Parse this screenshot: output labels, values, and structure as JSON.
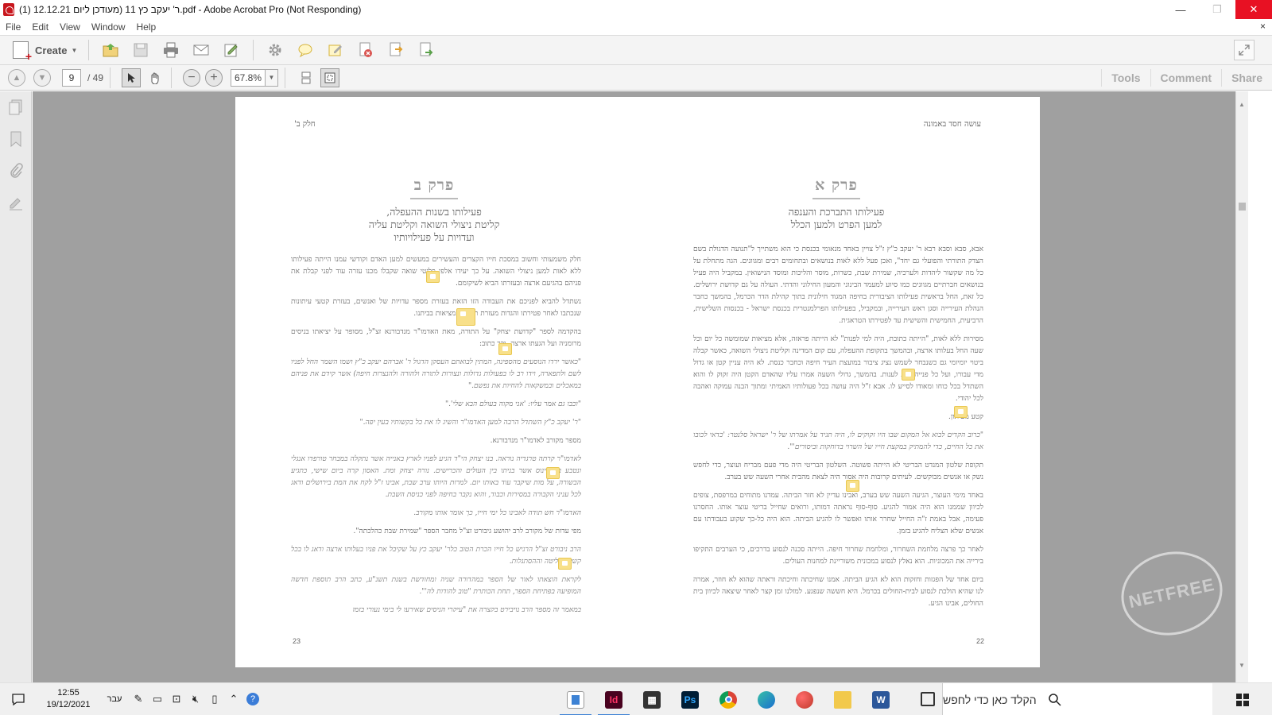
{
  "window": {
    "title": "ר' יעקב כץ 11 (מעודכן ליום 12.12.21 (1).pdf - Adobe Acrobat Pro (Not Responding)",
    "minimize": "—",
    "restore": "❐",
    "close": "✕"
  },
  "menu": {
    "items": [
      "File",
      "Edit",
      "View",
      "Window",
      "Help"
    ],
    "close_doc": "×"
  },
  "toolbar": {
    "create_label": "Create"
  },
  "nav": {
    "current_page": "9",
    "total_pages": "/ 49",
    "zoom": "67.8%"
  },
  "panes": {
    "tools": "Tools",
    "comment": "Comment",
    "share": "Share"
  },
  "document": {
    "right_page": {
      "header": "עושה חסד באמונה",
      "page_number": "22",
      "chapter_title": "פרק א",
      "subtitle_1": "פעילותו התברכת והענפה",
      "subtitle_2": "למען הפרט ולמען הכלל",
      "paragraphs": [
        "אבא, סבא וסבא רבא ר' יעקב כ\"ץ ז\"ל צויין באחד מנאומי בכנסת כי הוא משתייך ל\"תנועה הדגולת בשם הצדק התורתי והפועלי גם יחד\", ואכן פעל ללא לאות בנושאים ובתחומים רבים ומגוונים. הגה מתחלת על כל מה שקשור ליהדות ולערכיה, שמירת שבת, כשרות, מוסר והליכות ומוסד הנישואין. במקביל היה פעיל בנושאים חברתיים מגוונים כמו סיוע למעמד הבינוני והמעון החילוני והדתי. העולה על גם קדושת ירושלים. כל זאת, החל בראשית פעילותו הציבורית בחיפה המגוד חילונית בתוך קהילת הדר הכרמל, בהמשך כחבר הנהלת העירייה וסגן ראש העירייה, ובמקביל, בפעילותו הפרלמנטרית בכנסת ישראל - בכנסות השלישית, הרביעית, החמישית והשישית עד לפטירתו הטראגית.",
        "מסירות ללא לאות, \"הייתה כתובת, היה למי לפנות\" לא הייתה פראזה, אלא מציאות שמומשה כל יום וכל שעה החל בעלותו ארצה, ובהמשך בתקופת ההעפלה, עם קום המדינה וקליטת ניצולי השואה, כאשר קבלה ביטוי יומיומי גם כשנבחר לשמש נציג ציבור במועצת העיר חיפה וכחבר כנסת. לא היה עניין קטן או גדול מדי עבורו, ועל כל פנייה דאג לענות. בהמשך, גדולי השעה אמרו עליו שהאדם הקטן היה זקוק לו והוא השתדל בכל כוחו ומאודו לסייע לו. אבא ז\"ל היה עושה בכל פעולותיו האמיתי ומתוך הבנה עמוקה ואהבה לכל יהודי.",
        "קטע מעיתון.",
        "\"כרוב הקדים לבוא אל המקום שבו היו זקוקים לו, היה תגיד על אמרתו של ר' ישראל סלנטר: 'כדאי לכובו את כל החיים, כדי להמתיק במקצת חייו של השרוי בדוחקות וביסורים'\".",
        "תקופת שלטון המנדט הבריטי לא הייתה פשוטה. השלטון הבריטי היה מדי פעם מבריח ועוצר, כדי לחפש נשק או אנשים מבוקשים. לעיתים קרובות היה אסור היה לצאת מהבית אחרי השעה שש בערב.",
        "באחד מימי העוצר, הגיעה השעה שש בערב, ואבינו עדיין לא חזר הביתה. עמדנו מתוחים במרפסת, צופים לכיוון שממנו הוא היה אמור להגיע. סוף-סוף נראתה דמותו, ורואים שחייל בריטי עוצר אותו. החסרנו פעימה, אבל באמת ז\"ה החייל שחרר אותו ואפשר לו להגיע הביתה. הוא היה כל-כך שקוע בעבודתו עם אנשים שלא הצליח להגיע בזמן.",
        "לאחר כך פרצה מלחמת השחרור, ומלחמת שחרור חיפה. הייתה סכנה לנסוע בדרכים, כי הערבים התקיפו בירייה את המכוניות. הוא נאלץ לנסוע במכונית משוריינת למחנות העולים.",
        "ביום אחד של הפגזות וחזקות הוא לא הגיע הביתה. אמנו שחיכתה וחיכתה וראתה שהוא לא חוזר, אמרה לנו שהיא הולכת לנסוע לבית-החולים בכרמל. היא חששה שנפגע. למזלנו זמן קצר לאחר שיצאה לכיוון בית החולים, אבינו הגיע."
      ]
    },
    "left_page": {
      "header": "חלק ב'",
      "page_number": "23",
      "chapter_title": "פרק ב",
      "subtitle_1": "פעילותו בשנות ההעפלה,",
      "subtitle_2": "קליטת ניצולי השואה וקליטת עליה",
      "subtitle_3": "ועדויות על פעילויותיו",
      "paragraphs": [
        "חלק משמעותי וחשוב במסכת חייו הקצרים והעשירים במעשים למען האדם וקודשי עמנו הייתה פעילותו ללא לאות למען ניצולי השואה. על כך יעידו אלפי פליטי שואה שקבלו מכנו עזרה עוד לפני קבלת את פניהם בהגיעם ארצה ובעזרתו הביא לשיקומם.",
        "נשתדל להביא לפניכם את העבודה הזו הזאת בעזרת מספר עדויות של ואנשים, בעזרת קטעי עיתונות שנכתבו לאחר פטירתו והגדות מעזרת תיאור המציאות בביתנו.",
        "בהקדמה לספר \"קדושת יצחק\" על התורה, מאת האדמו\"ר מנדבורנא זצ\"ל, מסופר על יציאתו בניסים מרומניה ועל הגעתו ארצה. וכך כתוב:",
        "\"כאשר ירדו הנוסעים מהספינה, המתין לבואתם העסקן הדגול ר' אברהם יעקב כ\"ץ ושמו השמר החל לפניו לשם ולתפארה, וידו רב לו בפעולות גדולות ונצורות לתורה ולהורה ולהנצרות חיפה) אשר קידם את פניהם במאכלים ובמשקאות להחיות את נפשם.\"",
        "\"וכבו גם אמר עליו: 'אני מקוה בעולם הבא שלי'.\"",
        "\"ר' יעקב כ\"ץ השתדל הרבה למען האדמו\"ר והשיג לו את כל בקשותיו בעין יפה.\"",
        "מספר מקורב לאדמו\"ר מנדבורנא.",
        "לאדמו\"ר קרתה טרגדיה נוראה. בנו יצחק הי\"ד הגיע לפניו לארץ באנייה אשר נתקלה במבחר טורפדו אנגלי ונטבע באוקיינוס אשר בניתו בין העולים והכרישים. נורה יצחק ומת. האסון קרה ביום שישי, כתגיע הבשורה, על מות שיקבר עוד באותו יום. למרות היותו ערב שבת, אבינו ז\"ל לקח את המת בירושלים ודאג לכל עניני הקבורה במסירות וכבוד, והוא נקבר בחיפה לפני כניסת השבת.",
        "האדמו\"ר חש תודה לאבינו כל ימי חייו, כך אומר אותו מקורב.",
        "מפי עדות של מקורב לרב יהושע גיבורט זצ\"ל מחבר הספר \"שמירת שבת כהלכתה\".",
        "הרב ניבורט זצ\"ל הרגיש כל חייו הכרת הטוב כלר' יעקב כץ על שקיבל את פניו בעלותו ארצה ודאג לו בכל קשיי הקליטה וההסתגלות.",
        "לקראת הוצאתו לאור של הספר במהדורה שניה ומחודשת בשנת תשנ\"ע, כתב הרב תוספת חדשה המופיעה בפתיחת הספר, תחת הכותרת \"טוב להודות לה'\".",
        "במאמר זה מספר הרב נויבירט בקצרה את \"עיקרי הניסים שאירעו לי בימי נעורי בזמן"
      ]
    }
  },
  "watermark": "NETFREE",
  "taskbar": {
    "time": "12:55",
    "date": "19/12/2021",
    "language": "עבר",
    "search_placeholder": "הקלד כאן כדי לחפש",
    "apps": [
      {
        "name": "acrobat",
        "label": ""
      },
      {
        "name": "indesign",
        "label": "Id",
        "color": "#49021f"
      },
      {
        "name": "calculator",
        "label": "",
        "color": "#333333"
      },
      {
        "name": "photoshop",
        "label": "Ps",
        "color": "#001e36"
      },
      {
        "name": "chrome",
        "label": ""
      },
      {
        "name": "edge",
        "label": ""
      },
      {
        "name": "app-multi",
        "label": ""
      },
      {
        "name": "file-explorer",
        "label": "",
        "color": "#f2c94c"
      },
      {
        "name": "word",
        "label": "W",
        "color": "#2b579a"
      }
    ]
  },
  "colors": {
    "close_red": "#e81123",
    "doc_bg": "#a0a0a0",
    "note_yellow": "#f8e08a"
  }
}
